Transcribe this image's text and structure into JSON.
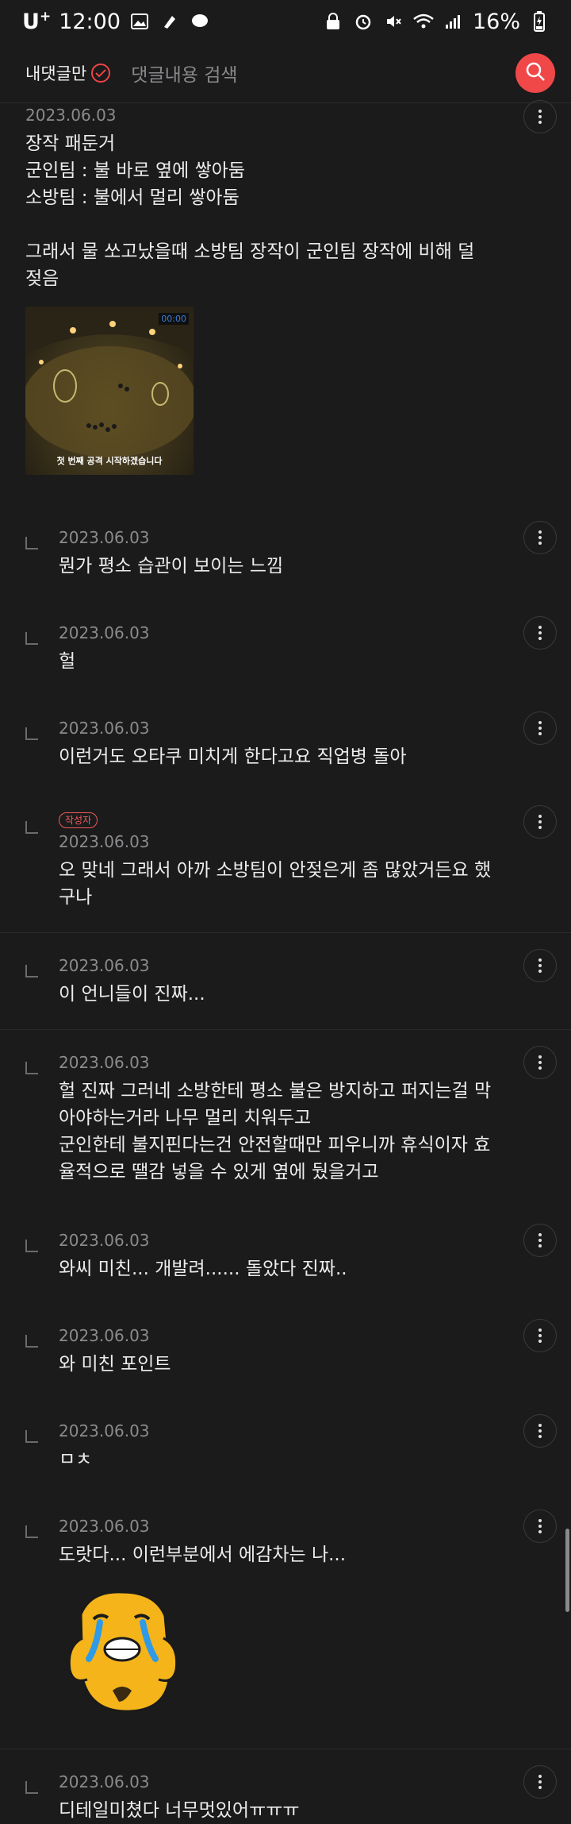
{
  "status_bar": {
    "carrier": "U",
    "carrier_plus": "+",
    "time": "12:00",
    "battery": "16%"
  },
  "header": {
    "my_comments_label": "내댓글만",
    "search_placeholder": "댓글내용 검색",
    "accent_color": "#f04848"
  },
  "comments": [
    {
      "date": "2023.06.03",
      "text": "장작 패둔거\n군인팀 : 불 바로 옆에 쌓아둠\n소방팀 : 불에서 멀리 쌓아둠\n\n그래서 물 쏘고났을때 소방팀 장작이 군인팀 장작에 비해 덜 젖음",
      "image_caption": "첫 번째 공격 시작하겠습니다",
      "image_time": "00:00"
    },
    {
      "date": "2023.06.03",
      "text": "뭔가 평소 습관이 보이는 느낌"
    },
    {
      "date": "2023.06.03",
      "text": "헐"
    },
    {
      "date": "2023.06.03",
      "text": "이런거도 오타쿠 미치게 한다고요 직업병 돌아"
    },
    {
      "date": "2023.06.03",
      "badge": "작성자",
      "text": "오 맞네 그래서 아까 소방팀이 안젖은게 좀 많았거든요 했구나"
    },
    {
      "date": "2023.06.03",
      "text": "이 언니들이 진짜..."
    },
    {
      "date": "2023.06.03",
      "text": "헐 진짜 그러네 소방한테 평소 불은 방지하고 퍼지는걸 막아야하는거라 나무 멀리 치워두고\n군인한테 불지핀다는건 안전할때만 피우니까 휴식이자 효율적으로 땔감 넣을 수 있게 옆에 뒀을거고"
    },
    {
      "date": "2023.06.03",
      "text": "와씨 미친... 개발려...... 돌았다 진짜.."
    },
    {
      "date": "2023.06.03",
      "text": "와 미친 포인트"
    },
    {
      "date": "2023.06.03",
      "text": "ㅁㅊ"
    },
    {
      "date": "2023.06.03",
      "text": "도랏다... 이런부분에서 에감차는 나..."
    },
    {
      "date": "2023.06.03",
      "text": "디테일미쳤다 너무멋있어ㅠㅠㅠ"
    }
  ]
}
